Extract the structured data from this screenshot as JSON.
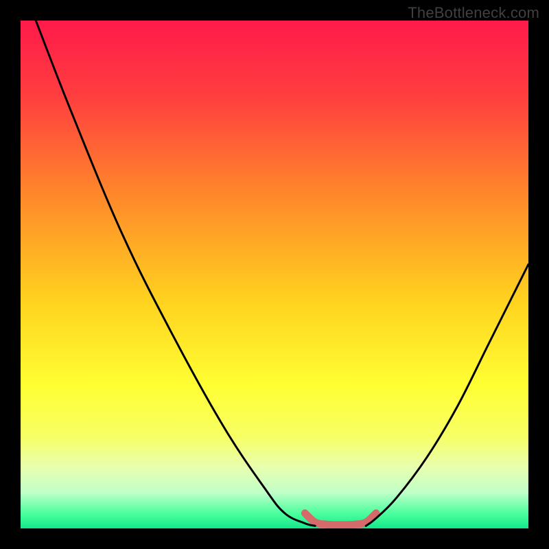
{
  "watermark": "TheBottleneck.com",
  "chart_data": {
    "type": "line",
    "title": "",
    "xlabel": "",
    "ylabel": "",
    "xlim": [
      0,
      100
    ],
    "ylim": [
      0,
      100
    ],
    "series": [
      {
        "name": "bottleneck-curve-left",
        "x": [
          3,
          10,
          20,
          30,
          40,
          48,
          52,
          56,
          58
        ],
        "values": [
          100,
          82,
          58,
          38,
          20,
          8,
          3,
          1,
          0.5
        ]
      },
      {
        "name": "bottleneck-curve-right",
        "x": [
          68,
          70,
          74,
          80,
          86,
          92,
          98,
          100
        ],
        "values": [
          0.5,
          2,
          6,
          14,
          24,
          36,
          48,
          52
        ]
      },
      {
        "name": "optimal-zone",
        "x": [
          56,
          58,
          60,
          62,
          64,
          66,
          68,
          70
        ],
        "values": [
          3,
          1.2,
          0.8,
          0.7,
          0.7,
          0.8,
          1.2,
          3
        ]
      }
    ],
    "gradient_stops": [
      {
        "pos": 0.0,
        "color": "#ff1a4a"
      },
      {
        "pos": 0.15,
        "color": "#ff3f3f"
      },
      {
        "pos": 0.35,
        "color": "#ff8a2a"
      },
      {
        "pos": 0.55,
        "color": "#ffd21f"
      },
      {
        "pos": 0.72,
        "color": "#ffff33"
      },
      {
        "pos": 0.82,
        "color": "#f7ff66"
      },
      {
        "pos": 0.88,
        "color": "#e8ffb0"
      },
      {
        "pos": 0.93,
        "color": "#bfffc8"
      },
      {
        "pos": 0.97,
        "color": "#4dff9e"
      },
      {
        "pos": 1.0,
        "color": "#12e88a"
      }
    ],
    "optimal_color": "#d46a6a",
    "curve_color": "#000000"
  }
}
